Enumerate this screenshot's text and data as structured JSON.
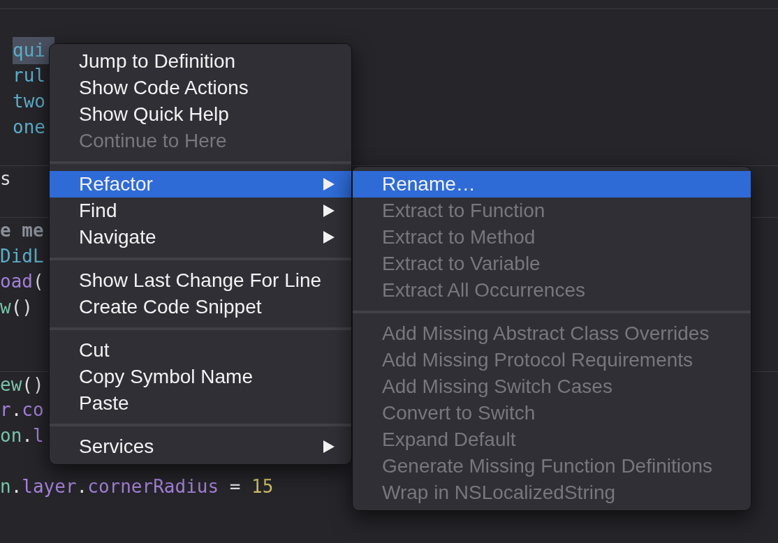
{
  "code_sections": [
    {
      "lines": [
        {
          "kind": "code",
          "segments": [
            {
              "text": "qui",
              "kind": "property",
              "selected": true
            }
          ]
        },
        {
          "kind": "code",
          "segments": [
            {
              "text": "rul",
              "kind": "property",
              "selected": false
            }
          ]
        },
        {
          "kind": "code",
          "segments": [
            {
              "text": "two",
              "kind": "property",
              "selected": false
            }
          ]
        },
        {
          "kind": "code",
          "segments": [
            {
              "text": "one",
              "kind": "property",
              "selected": false
            }
          ]
        },
        {
          "kind": "blank"
        }
      ]
    },
    {
      "lines": [
        {
          "kind": "code",
          "segments": [
            {
              "text": "s",
              "kind": "plain",
              "selected": false
            }
          ]
        },
        {
          "kind": "blank"
        }
      ]
    },
    {
      "lines": [
        {
          "kind": "code",
          "segments": [
            {
              "text": "e me",
              "kind": "comment",
              "selected": false
            }
          ]
        },
        {
          "kind": "code",
          "segments": [
            {
              "text": "DidL",
              "kind": "property",
              "selected": false
            }
          ]
        },
        {
          "kind": "code",
          "segments": [
            {
              "text": "oad",
              "kind": "method",
              "selected": false
            },
            {
              "text": "(",
              "kind": "plain",
              "selected": false
            }
          ]
        },
        {
          "kind": "code",
          "segments": [
            {
              "text": "w",
              "kind": "type",
              "selected": false
            },
            {
              "text": "()",
              "kind": "plain",
              "selected": false
            }
          ]
        },
        {
          "kind": "blank"
        },
        {
          "kind": "blank"
        }
      ]
    },
    {
      "lines": [
        {
          "kind": "code",
          "segments": [
            {
              "text": "ew",
              "kind": "type",
              "selected": false
            },
            {
              "text": "()",
              "kind": "plain",
              "selected": false
            }
          ]
        },
        {
          "kind": "code",
          "segments": [
            {
              "text": "r",
              "kind": "method",
              "selected": false
            },
            {
              "text": ".",
              "kind": "plain",
              "selected": false
            },
            {
              "text": "co",
              "kind": "method",
              "selected": false
            }
          ]
        },
        {
          "kind": "code",
          "segments": [
            {
              "text": "on",
              "kind": "type",
              "selected": false
            },
            {
              "text": ".",
              "kind": "plain",
              "selected": false
            },
            {
              "text": "l",
              "kind": "method",
              "selected": false
            }
          ]
        },
        {
          "kind": "blank"
        },
        {
          "kind": "code",
          "segments": [
            {
              "text": "n",
              "kind": "type",
              "selected": false
            },
            {
              "text": ".",
              "kind": "plain",
              "selected": false
            },
            {
              "text": "layer",
              "kind": "method",
              "selected": false
            },
            {
              "text": ".",
              "kind": "plain",
              "selected": false
            },
            {
              "text": "cornerRadius",
              "kind": "method",
              "selected": false
            },
            {
              "text": " = ",
              "kind": "plain",
              "selected": false
            },
            {
              "text": "15",
              "kind": "number",
              "selected": false
            }
          ]
        }
      ]
    }
  ],
  "menu": {
    "items": [
      {
        "kind": "item",
        "label": "Jump to Definition",
        "disabled": false,
        "highlighted": false,
        "has_submenu": false
      },
      {
        "kind": "item",
        "label": "Show Code Actions",
        "disabled": false,
        "highlighted": false,
        "has_submenu": false
      },
      {
        "kind": "item",
        "label": "Show Quick Help",
        "disabled": false,
        "highlighted": false,
        "has_submenu": false
      },
      {
        "kind": "item",
        "label": "Continue to Here",
        "disabled": true,
        "highlighted": false,
        "has_submenu": false
      },
      {
        "kind": "separator"
      },
      {
        "kind": "item",
        "label": "Refactor",
        "disabled": false,
        "highlighted": true,
        "has_submenu": true
      },
      {
        "kind": "item",
        "label": "Find",
        "disabled": false,
        "highlighted": false,
        "has_submenu": true
      },
      {
        "kind": "item",
        "label": "Navigate",
        "disabled": false,
        "highlighted": false,
        "has_submenu": true
      },
      {
        "kind": "separator"
      },
      {
        "kind": "item",
        "label": "Show Last Change For Line",
        "disabled": false,
        "highlighted": false,
        "has_submenu": false
      },
      {
        "kind": "item",
        "label": "Create Code Snippet",
        "disabled": false,
        "highlighted": false,
        "has_submenu": false
      },
      {
        "kind": "separator"
      },
      {
        "kind": "item",
        "label": "Cut",
        "disabled": false,
        "highlighted": false,
        "has_submenu": false
      },
      {
        "kind": "item",
        "label": "Copy Symbol Name",
        "disabled": false,
        "highlighted": false,
        "has_submenu": false
      },
      {
        "kind": "item",
        "label": "Paste",
        "disabled": false,
        "highlighted": false,
        "has_submenu": false
      },
      {
        "kind": "separator"
      },
      {
        "kind": "item",
        "label": "Services",
        "disabled": false,
        "highlighted": false,
        "has_submenu": true
      }
    ]
  },
  "submenu": {
    "items": [
      {
        "kind": "item",
        "label": "Rename…",
        "disabled": false,
        "highlighted": true,
        "has_submenu": false
      },
      {
        "kind": "item",
        "label": "Extract to Function",
        "disabled": true,
        "highlighted": false,
        "has_submenu": false
      },
      {
        "kind": "item",
        "label": "Extract to Method",
        "disabled": true,
        "highlighted": false,
        "has_submenu": false
      },
      {
        "kind": "item",
        "label": "Extract to Variable",
        "disabled": true,
        "highlighted": false,
        "has_submenu": false
      },
      {
        "kind": "item",
        "label": "Extract All Occurrences",
        "disabled": true,
        "highlighted": false,
        "has_submenu": false
      },
      {
        "kind": "separator"
      },
      {
        "kind": "item",
        "label": "Add Missing Abstract Class Overrides",
        "disabled": true,
        "highlighted": false,
        "has_submenu": false
      },
      {
        "kind": "item",
        "label": "Add Missing Protocol Requirements",
        "disabled": true,
        "highlighted": false,
        "has_submenu": false
      },
      {
        "kind": "item",
        "label": "Add Missing Switch Cases",
        "disabled": true,
        "highlighted": false,
        "has_submenu": false
      },
      {
        "kind": "item",
        "label": "Convert to Switch",
        "disabled": true,
        "highlighted": false,
        "has_submenu": false
      },
      {
        "kind": "item",
        "label": "Expand Default",
        "disabled": true,
        "highlighted": false,
        "has_submenu": false
      },
      {
        "kind": "item",
        "label": "Generate Missing Function Definitions",
        "disabled": true,
        "highlighted": false,
        "has_submenu": false
      },
      {
        "kind": "item",
        "label": "Wrap in NSLocalizedString",
        "disabled": true,
        "highlighted": false,
        "has_submenu": false
      }
    ]
  }
}
